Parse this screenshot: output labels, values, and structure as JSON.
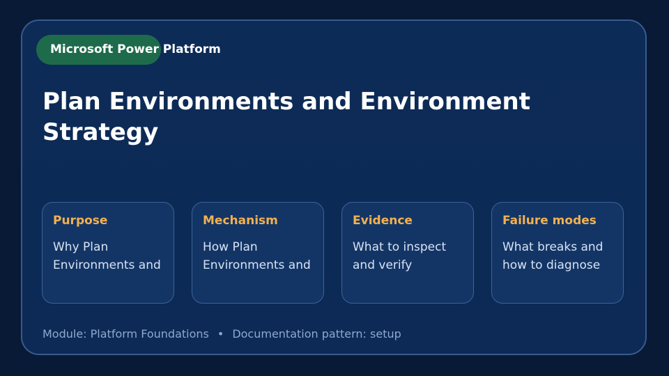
{
  "badge": "Microsoft Power Platform",
  "title": "Plan Environments and Environment Strategy",
  "tiles": [
    {
      "heading": "Purpose",
      "body": "Why Plan Environments and"
    },
    {
      "heading": "Mechanism",
      "body": "How Plan Environments and"
    },
    {
      "heading": "Evidence",
      "body": "What to inspect and verify"
    },
    {
      "heading": "Failure modes",
      "body": "What breaks and how to diagnose"
    }
  ],
  "footer": {
    "module": "Module: Platform Foundations",
    "separator": "•",
    "pattern": "Documentation pattern: setup"
  },
  "colors": {
    "background": "#081a36",
    "card": "#0d2b57",
    "badge": "#1e6b4b",
    "tile_heading": "#f2b150"
  }
}
